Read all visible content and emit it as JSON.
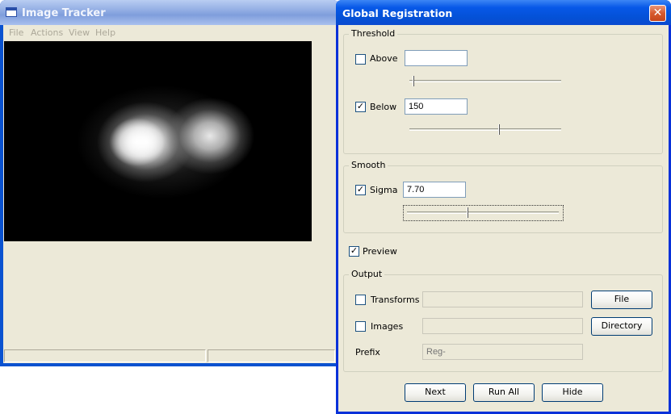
{
  "background_window": {
    "title": "Image Tracker",
    "menu": [
      "File",
      "Actions",
      "View",
      "Help"
    ]
  },
  "dialog": {
    "title": "Global Registration",
    "close_glyph": "✕",
    "threshold": {
      "label": "Threshold",
      "above": {
        "label": "Above",
        "checked": false,
        "value": "",
        "slider_fraction": 0.0
      },
      "below": {
        "label": "Below",
        "checked": true,
        "value": "150",
        "slider_fraction": 0.59
      }
    },
    "smooth": {
      "label": "Smooth",
      "sigma": {
        "label": "Sigma",
        "checked": true,
        "value": "7.70",
        "slider_fraction": 0.41
      }
    },
    "preview": {
      "label": "Preview",
      "checked": true
    },
    "output": {
      "label": "Output",
      "transforms": {
        "label": "Transforms",
        "checked": false,
        "value": "",
        "button": "File"
      },
      "images": {
        "label": "Images",
        "checked": false,
        "value": "",
        "button": "Directory"
      },
      "prefix": {
        "label": "Prefix",
        "placeholder": "Reg-"
      }
    },
    "buttons": {
      "next": "Next",
      "run_all": "Run All",
      "hide": "Hide"
    }
  },
  "check_glyph": "✓",
  "colors": {
    "dialog_title": "#0758e8",
    "bg_title": "#8eaae2",
    "face": "#ece9d8"
  }
}
